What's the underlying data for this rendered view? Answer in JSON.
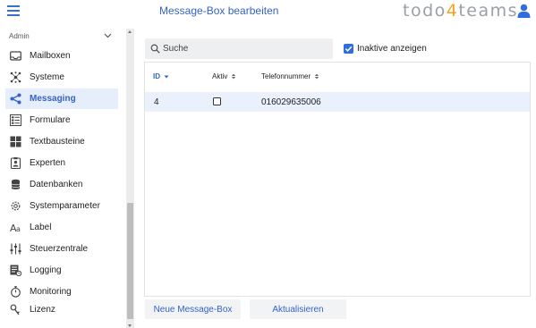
{
  "header": {
    "title": "Message-Box bearbeiten",
    "brand_prefix": "todo",
    "brand_accent": "4",
    "brand_suffix": "teams",
    "brand_accent_color": "#f0a31d",
    "accent_color": "#3563c9"
  },
  "sidebar": {
    "group_label": "Admin",
    "items": [
      {
        "label": "Mailboxen",
        "icon": "inbox-icon",
        "active": false
      },
      {
        "label": "Systeme",
        "icon": "network-icon",
        "active": false
      },
      {
        "label": "Messaging",
        "icon": "share-icon",
        "active": true
      },
      {
        "label": "Formulare",
        "icon": "form-list-icon",
        "active": false
      },
      {
        "label": "Textbausteine",
        "icon": "grid-blocks-icon",
        "active": false
      },
      {
        "label": "Experten",
        "icon": "badge-icon",
        "active": false
      },
      {
        "label": "Datenbanken",
        "icon": "database-icon",
        "active": false
      },
      {
        "label": "Systemparameter",
        "icon": "gear-icon",
        "active": false
      },
      {
        "label": "Label",
        "icon": "text-aa-icon",
        "active": false
      },
      {
        "label": "Steuerzentrale",
        "icon": "sliders-icon",
        "active": false
      },
      {
        "label": "Logging",
        "icon": "log-icon",
        "active": false
      },
      {
        "label": "Monitoring",
        "icon": "stopwatch-icon",
        "active": false
      },
      {
        "label": "Lizenz",
        "icon": "key-icon",
        "active": false
      }
    ]
  },
  "toolbar": {
    "search_placeholder": "Suche",
    "search_value": "",
    "inactive_label": "Inaktive anzeigen",
    "inactive_checked": true
  },
  "table": {
    "columns": [
      {
        "label": "ID",
        "sort": "desc"
      },
      {
        "label": "Aktiv",
        "sort": "none"
      },
      {
        "label": "Telefonnummer",
        "sort": "none"
      }
    ],
    "rows": [
      {
        "id": "4",
        "active": false,
        "phone": "016029635006"
      }
    ]
  },
  "actions": {
    "new_label": "Neue Message-Box",
    "refresh_label": "Aktualisieren"
  }
}
